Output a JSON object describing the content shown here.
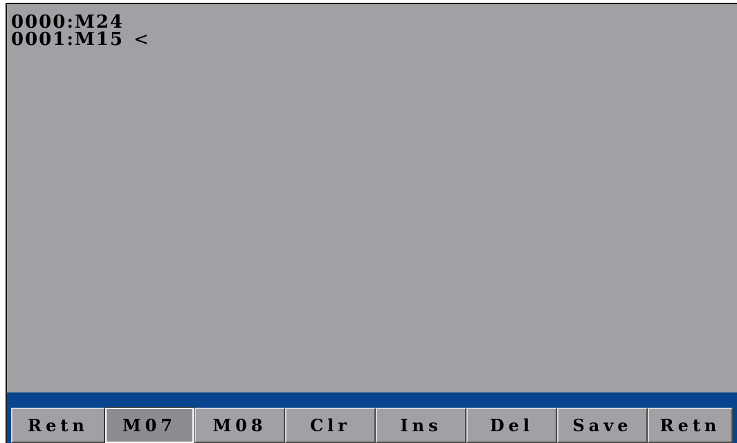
{
  "program": {
    "lines": [
      {
        "text": "0000:M24",
        "cursor": ""
      },
      {
        "text": "0001:M15",
        "cursor": "<"
      }
    ]
  },
  "softkeys": [
    {
      "label": "Retn",
      "selected": false
    },
    {
      "label": "M07",
      "selected": true
    },
    {
      "label": "M08",
      "selected": false
    },
    {
      "label": "Clr",
      "selected": false
    },
    {
      "label": "Ins",
      "selected": false
    },
    {
      "label": "Del",
      "selected": false
    },
    {
      "label": "Save",
      "selected": false
    },
    {
      "label": "Retn",
      "selected": false
    }
  ],
  "colors": {
    "screen_background": "#a1a0a5",
    "softkey_bar": "#09458f"
  }
}
